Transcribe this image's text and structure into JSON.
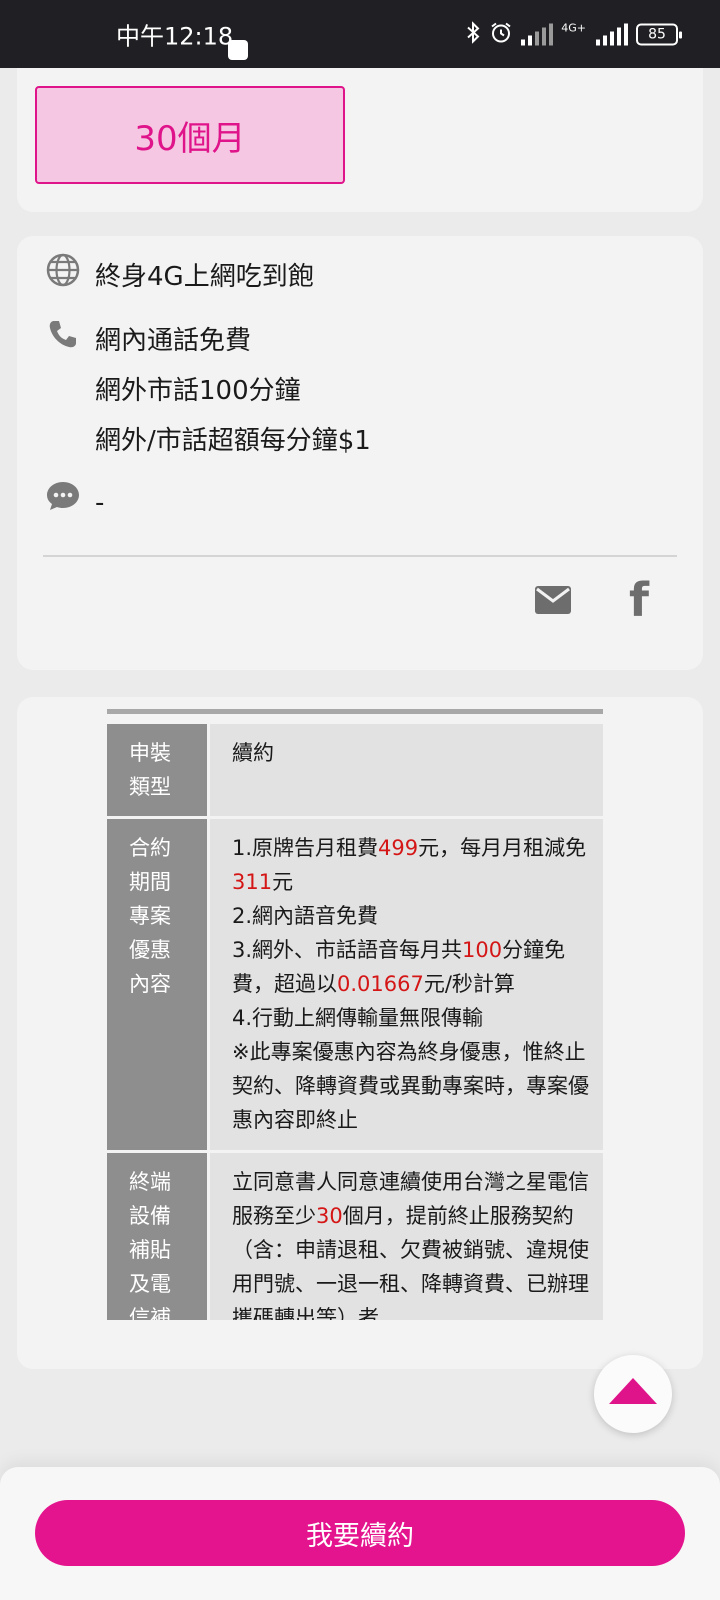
{
  "status_bar": {
    "time": "中午12:18",
    "network": "4G+",
    "battery": "85"
  },
  "contract": {
    "period_label": "30個月"
  },
  "features": {
    "data": "終身4G上網吃到飽",
    "voice": [
      "網內通話免費",
      "網外市話100分鐘",
      "網外/市話超額每分鐘$1"
    ],
    "sms": "-"
  },
  "share": {
    "email_icon": "mail-icon",
    "facebook_icon": "facebook-icon",
    "facebook_glyph": "f"
  },
  "details_table": {
    "rows": [
      {
        "header": [
          "申裝",
          "類型"
        ],
        "content": "續約"
      },
      {
        "header": [
          "合約",
          "期間",
          "專案",
          "優惠",
          "內容"
        ],
        "line1_a": "1.原牌告月租費",
        "line1_price": "499",
        "line1_b": "元，每月月租減免",
        "line1_discount": "311",
        "line1_c": "元",
        "line2": "2.網內語音免費",
        "line3_a": "3.網外、市話語音每月共",
        "line3_minutes": "100",
        "line3_b": "分鐘免費，超過以",
        "line3_rate": "0.01667",
        "line3_c": "元/秒計算",
        "line4": "4.行動上網傳輸量無限傳輸",
        "note": "※此專案優惠內容為終身優惠，惟終止契約、降轉資費或異動專案時，專案優惠內容即終止"
      },
      {
        "header": [
          "終端",
          "設備",
          "補貼",
          "及電",
          "信補"
        ],
        "text_a": "立同意書人同意連續使用台灣之星電信服務至少",
        "months": "30",
        "text_b": "個月，提前終止服務契約（含：申請退租、欠費被銷號、違規使用門號、一退一租、降轉資費、已辦理攜碼轉出等）者，"
      }
    ]
  },
  "colors": {
    "brand_pink": "#e4148e",
    "highlight_red": "#d41616"
  },
  "action": {
    "primary_button": "我要續約"
  }
}
